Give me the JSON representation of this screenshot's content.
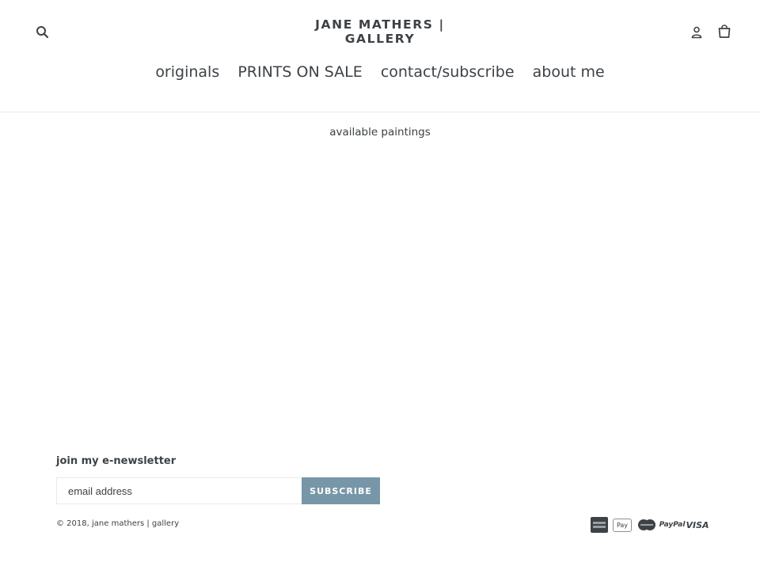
{
  "header": {
    "logo_text": "JANE MATHERS | GALLERY",
    "search_icon": "search-icon",
    "account_icon": "user-icon",
    "cart_icon": "shopping-bag-icon"
  },
  "nav": {
    "items": [
      {
        "label": "originals"
      },
      {
        "label": "PRINTS ON SALE"
      },
      {
        "label": "contact/subscribe"
      },
      {
        "label": "about me"
      }
    ]
  },
  "main": {
    "title": "available paintings"
  },
  "footer": {
    "newsletter_label": "join my e-newsletter",
    "email_placeholder": "email address",
    "subscribe_label": "SUBSCRIBE",
    "copyright_prefix": "© 2018, ",
    "copyright_link": "jane mathers | gallery",
    "payment_icons": [
      {
        "name": "american-express-icon"
      },
      {
        "name": "apple-pay-icon",
        "label": "Pay"
      },
      {
        "name": "mastercard-icon"
      },
      {
        "name": "paypal-icon",
        "label": "PayPal"
      },
      {
        "name": "visa-icon",
        "label": "VISA"
      }
    ],
    "accent_color": "#7796a8"
  }
}
